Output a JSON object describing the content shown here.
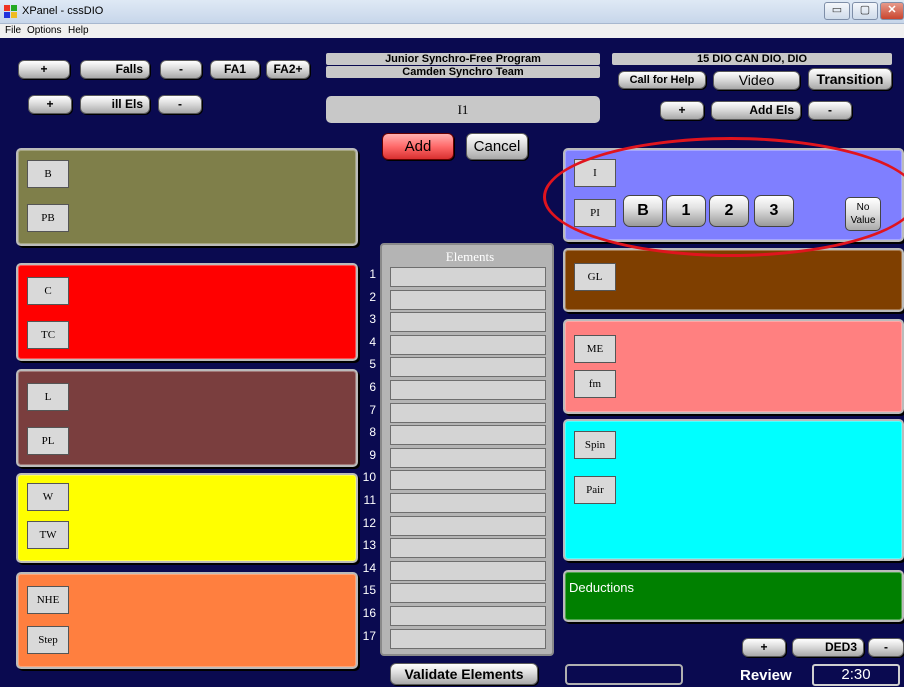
{
  "window": {
    "title": "XPanel - cssDIO",
    "minimize": "▭",
    "maximize": "▢",
    "close": "✕"
  },
  "menu": [
    "File",
    "Options",
    "Help"
  ],
  "header": {
    "program_name": "Junior Synchro-Free Program",
    "team_name": "Camden Synchro Team",
    "judge_name": "15 DIO CAN DIO, DIO",
    "current_element": "I1"
  },
  "toolbar": {
    "falls_plus": "+",
    "falls_label": "Falls",
    "falls_minus": "-",
    "fa1_label": "FA1",
    "fa2_label": "FA2+",
    "ill_plus": "+",
    "ill_label": "ill Els",
    "ill_minus": "-",
    "call_help_label": "Call for Help",
    "video_label": "Video",
    "transition_label": "Transition",
    "add_els_plus": "+",
    "add_els_label": "Add Els",
    "add_els_minus": "-",
    "add_label": "Add",
    "cancel_label": "Cancel"
  },
  "panels": {
    "b": {
      "buttons": [
        "B",
        "PB"
      ],
      "color": "#7f7f4a"
    },
    "c": {
      "buttons": [
        "C",
        "TC"
      ],
      "color": "#ff0000"
    },
    "l": {
      "buttons": [
        "L",
        "PL"
      ],
      "color": "#7a3e3e"
    },
    "w": {
      "buttons": [
        "W",
        "TW"
      ],
      "color": "#ffff00"
    },
    "nhe": {
      "buttons": [
        "NHE",
        "Step"
      ],
      "color": "#ff7f3f"
    },
    "i": {
      "buttons": [
        "I",
        "PI"
      ],
      "levels": [
        "B",
        "1",
        "2",
        "3"
      ],
      "no_value": "No Value",
      "color": "#7f7fff"
    },
    "gl": {
      "buttons": [
        "GL"
      ],
      "color": "#7f3f00"
    },
    "me": {
      "buttons": [
        "ME",
        "fm"
      ],
      "color": "#ff8080"
    },
    "spin": {
      "buttons": [
        "Spin",
        "Pair"
      ],
      "color": "#00ffff"
    },
    "deductions": {
      "label": "Deductions",
      "color": "#008000"
    }
  },
  "elements": {
    "header": "Elements",
    "rows": [
      "1",
      "2",
      "3",
      "4",
      "5",
      "6",
      "7",
      "8",
      "9",
      "10",
      "11",
      "12",
      "13",
      "14",
      "15",
      "16",
      "17"
    ],
    "validate_label": "Validate Elements"
  },
  "footer": {
    "ded_plus": "+",
    "ded_label": "DED3",
    "ded_minus": "-",
    "review_label": "Review",
    "timer": "2:30"
  }
}
